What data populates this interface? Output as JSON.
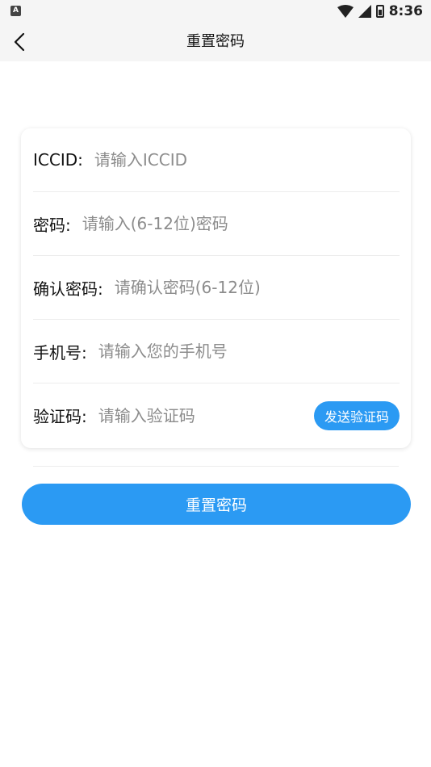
{
  "status_bar": {
    "app_icon_label": "A",
    "time": "8:36"
  },
  "header": {
    "title": "重置密码"
  },
  "form": {
    "fields": [
      {
        "label": "ICCID:",
        "placeholder": "请输入ICCID",
        "value": ""
      },
      {
        "label": "密码:",
        "placeholder": "请输入(6-12位)密码",
        "value": ""
      },
      {
        "label": "确认密码:",
        "placeholder": "请确认密码(6-12位)",
        "value": ""
      },
      {
        "label": "手机号:",
        "placeholder": "请输入您的手机号",
        "value": ""
      },
      {
        "label": "验证码:",
        "placeholder": "请输入验证码",
        "value": ""
      }
    ],
    "send_code_label": "发送验证码"
  },
  "submit": {
    "label": "重置密码"
  },
  "colors": {
    "accent": "#2b9af3",
    "header_bg": "#f5f5f5"
  },
  "icons": [
    "app-notification-icon",
    "wifi-icon",
    "signal-icon",
    "battery-icon",
    "back-arrow-icon"
  ]
}
